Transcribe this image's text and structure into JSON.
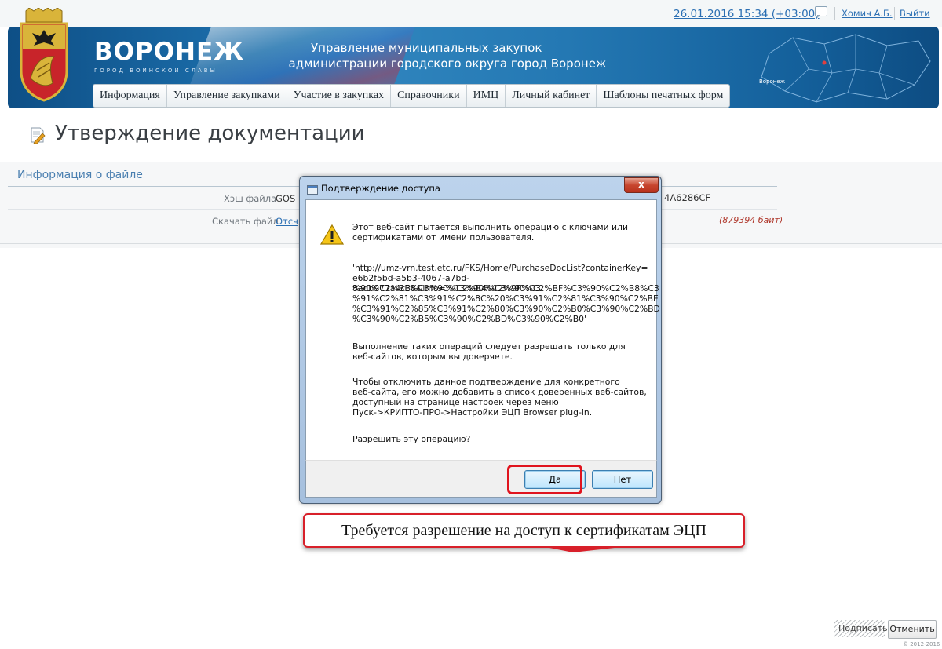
{
  "topbar": {
    "datetime": "26.01.2016 15:34 (+03:00)",
    "user": "Хомич А.Б.",
    "logout": "Выйти"
  },
  "banner": {
    "city_name": "ВОРОНЕЖ",
    "city_subtitle": "ГОРОД ВОИНСКОЙ СЛАВЫ",
    "title_line1": "Управление муниципальных закупок",
    "title_line2": "администрации городского округа город Воронеж",
    "map_label": "Воронеж"
  },
  "menu": {
    "items": [
      "Информация",
      "Управление закупками",
      "Участие в закупках",
      "Справочники",
      "ИМЦ",
      "Личный кабинет",
      "Шаблоны печатных форм"
    ]
  },
  "page": {
    "title": "Утверждение документации"
  },
  "file_info": {
    "heading": "Информация о файле",
    "hash_label": "Хэш файла",
    "hash_value_start": "GOS",
    "hash_value_end": "4A6286CF",
    "download_label": "Скачать файл",
    "download_link": "Отсч",
    "size": "(879394 байт)"
  },
  "dialog": {
    "title": "Подтверждение доступа",
    "close": "x",
    "line1": "Этот веб-сайт пытается выполнить операцию с ключами или",
    "line2": "сертификатами от имени пользователя.",
    "url_lines": [
      "'http://umz-vrn.test.etc.ru/FKS/Home/PurchaseDocList?containerKey=",
      "e6b2f5bd-a5b3-4067-a7bd-8adb977a4c38&info=%C3%90%C2%9F%C3",
      "%90%C2%BE%C3%90%C2%B4%C3%90%C2%BF%C3%90%C2%B8%C3",
      "%91%C2%81%C3%91%C2%8C%20%C3%91%C2%81%C3%90%C2%BE",
      "%C3%91%C2%85%C3%91%C2%80%C3%90%C2%B0%C3%90%C2%BD",
      "%C3%90%C2%B5%C3%90%C2%BD%C3%90%C2%B0'"
    ],
    "trust_lines": [
      "Выполнение таких операций следует разрешать только для",
      "веб-сайтов, которым вы доверяете."
    ],
    "disable_lines": [
      "Чтобы отключить данное подтверждение для конкретного",
      "веб-сайта, его можно добавить в список доверенных веб-сайтов,",
      "доступный на странице настроек через меню",
      "Пуск->КРИПТО-ПРО->Настройки ЭЦП Browser plug-in."
    ],
    "question": "Разрешить эту операцию?",
    "yes": "Да",
    "no": "Нет"
  },
  "callout": {
    "text": "Требуется разрешение на доступ к сертификатам ЭЦП"
  },
  "footer": {
    "sign": "Подписать",
    "cancel": "Отменить",
    "copyright": "© 2012-2016"
  },
  "colors": {
    "banner": "#1a6aa6",
    "link": "#2b6fb3",
    "highlight": "#e0141e"
  }
}
